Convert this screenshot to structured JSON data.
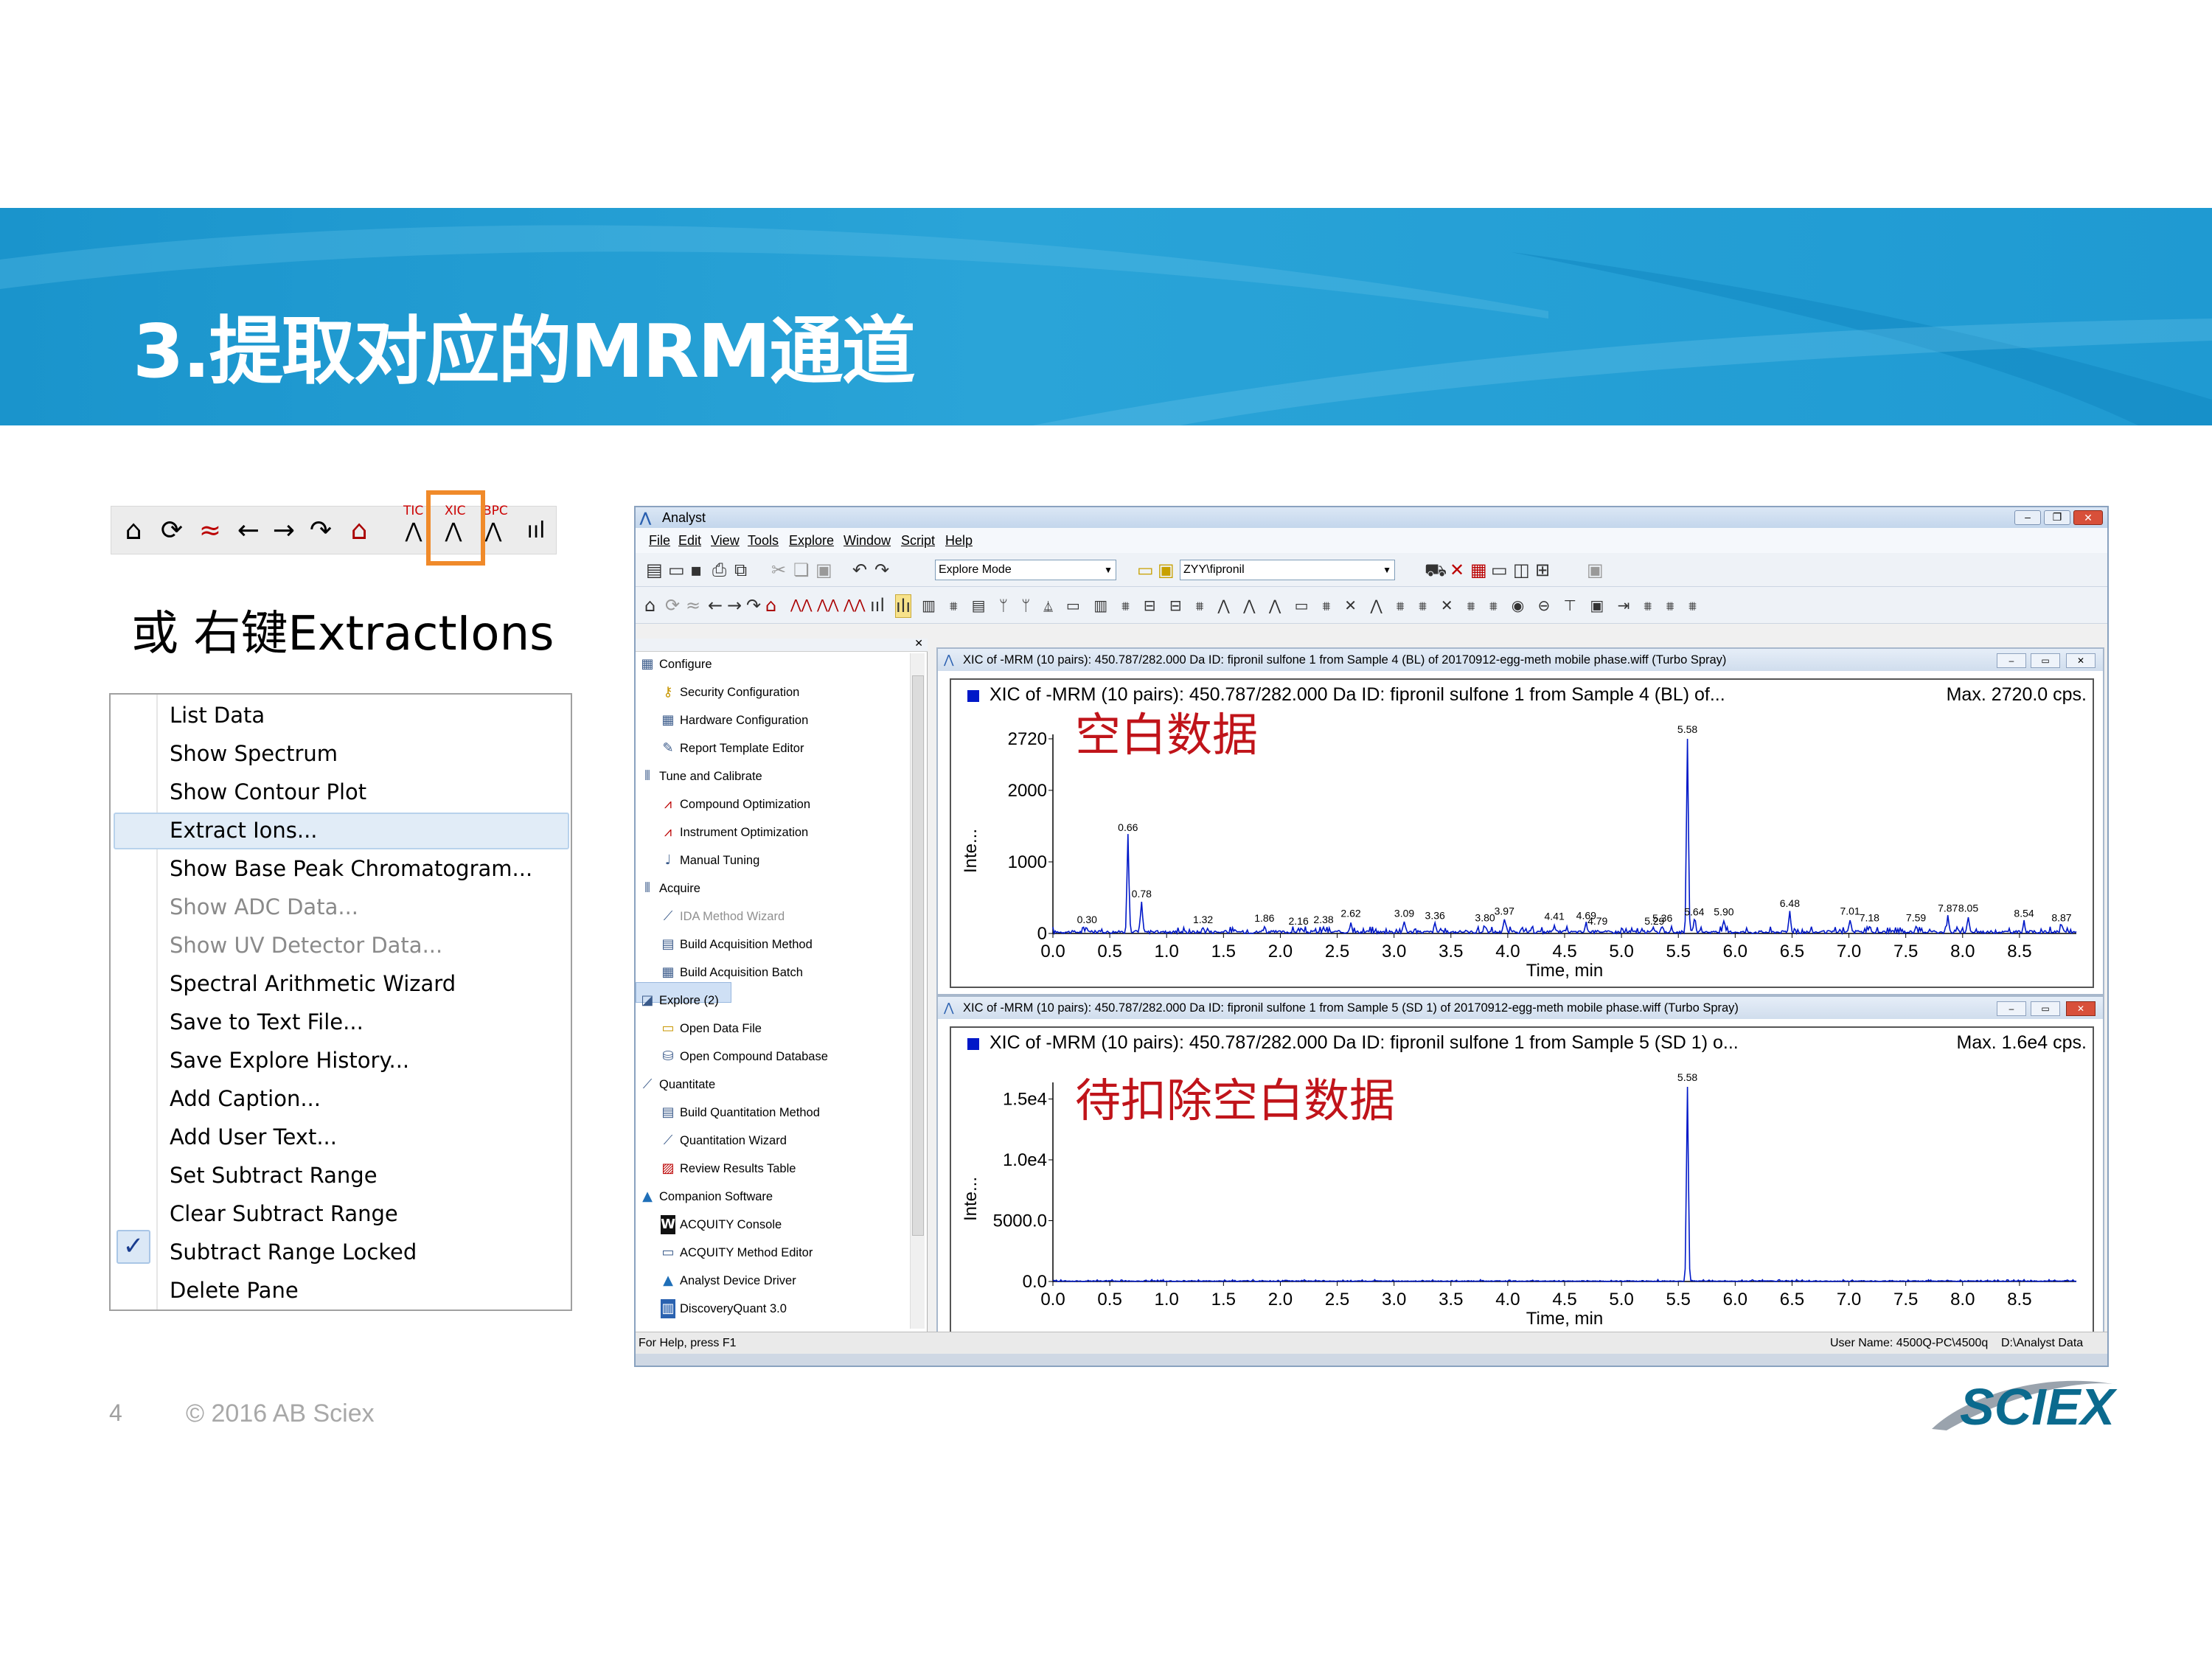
{
  "slide": {
    "title": "3.提取对应的MRM通道",
    "or_text": "或 右键ExtractIons",
    "page_number": "4",
    "copyright": "© 2016 AB Sciex",
    "logo": "SCIEX",
    "brand_color": "#1a94cc",
    "annotation_color": "#c0141a"
  },
  "toolbar_strip": {
    "icons": [
      "home-icon",
      "refresh-icon",
      "cross-wave-icon",
      "arrow-left-icon",
      "arrow-right-icon",
      "redo-icon",
      "calibrate-icon",
      "tic-icon",
      "xic-icon",
      "bpc-icon",
      "spectrum-icon"
    ],
    "labels": {
      "tic": "TIC",
      "xic": "XIC",
      "bpc": "BPC"
    }
  },
  "context_menu": {
    "items": [
      {
        "label": "List Data",
        "disabled": false
      },
      {
        "label": "Show Spectrum",
        "disabled": false
      },
      {
        "label": "Show Contour Plot",
        "disabled": false
      },
      {
        "label": "Extract Ions...",
        "disabled": false,
        "highlighted": true
      },
      {
        "label": "Show Base Peak Chromatogram...",
        "disabled": false
      },
      {
        "label": "Show ADC Data...",
        "disabled": true
      },
      {
        "label": "Show UV Detector Data...",
        "disabled": true
      },
      {
        "label": "Spectral Arithmetic Wizard",
        "disabled": false
      },
      {
        "label": "Save to Text File...",
        "disabled": false
      },
      {
        "label": "Save Explore History...",
        "disabled": false
      },
      {
        "label": "Add Caption...",
        "disabled": false
      },
      {
        "label": "Add User Text...",
        "disabled": false
      },
      {
        "label": "Set Subtract Range",
        "disabled": false
      },
      {
        "label": "Clear Subtract Range",
        "disabled": false
      },
      {
        "label": "Subtract Range Locked",
        "disabled": false,
        "checked": true
      },
      {
        "label": "Delete Pane",
        "disabled": false
      }
    ]
  },
  "analyst": {
    "window_title": "Analyst",
    "menu": [
      "File",
      "Edit",
      "View",
      "Tools",
      "Explore",
      "Window",
      "Script",
      "Help"
    ],
    "mode_combo": "Explore Mode",
    "project_combo": "ZYY\\fipronil",
    "nav": [
      {
        "label": "Configure",
        "level": 0,
        "icon": "configure-icon"
      },
      {
        "label": "Security Configuration",
        "level": 1,
        "icon": "key-icon"
      },
      {
        "label": "Hardware Configuration",
        "level": 1,
        "icon": "hardware-icon"
      },
      {
        "label": "Report Template Editor",
        "level": 1,
        "icon": "report-icon"
      },
      {
        "label": "Tune and Calibrate",
        "level": 0,
        "icon": "tune-icon"
      },
      {
        "label": "Compound Optimization",
        "level": 1,
        "icon": "compound-icon"
      },
      {
        "label": "Instrument Optimization",
        "level": 1,
        "icon": "instrument-icon"
      },
      {
        "label": "Manual Tuning",
        "level": 1,
        "icon": "manual-tuning-icon"
      },
      {
        "label": "Acquire",
        "level": 0,
        "icon": "acquire-icon"
      },
      {
        "label": "IDA Method Wizard",
        "level": 1,
        "icon": "wizard-icon",
        "disabled": true
      },
      {
        "label": "Build Acquisition Method",
        "level": 1,
        "icon": "method-icon"
      },
      {
        "label": "Build Acquisition Batch",
        "level": 1,
        "icon": "batch-icon"
      },
      {
        "label": "Explore (2)",
        "level": 0,
        "icon": "explore-icon",
        "selected": true
      },
      {
        "label": "Open Data File",
        "level": 1,
        "icon": "open-folder-icon"
      },
      {
        "label": "Open Compound Database",
        "level": 1,
        "icon": "database-icon"
      },
      {
        "label": "Quantitate",
        "level": 0,
        "icon": "quantitate-icon"
      },
      {
        "label": "Build Quantitation Method",
        "level": 1,
        "icon": "quant-method-icon"
      },
      {
        "label": "Quantitation Wizard",
        "level": 1,
        "icon": "wizard-icon"
      },
      {
        "label": "Review Results Table",
        "level": 1,
        "icon": "results-icon"
      },
      {
        "label": "Companion Software",
        "level": 0,
        "icon": "companion-icon"
      },
      {
        "label": "ACQUITY Console",
        "level": 1,
        "icon": "acquity-icon"
      },
      {
        "label": "ACQUITY Method Editor",
        "level": 1,
        "icon": "acquity-editor-icon"
      },
      {
        "label": "Analyst Device Driver",
        "level": 1,
        "icon": "driver-icon"
      },
      {
        "label": "DiscoveryQuant 3.0",
        "level": 1,
        "icon": "discoveryquant-icon"
      }
    ],
    "status_left": "For Help, press F1",
    "status_user": "User Name: 4500Q-PC\\4500q",
    "status_path": "D:\\Analyst Data"
  },
  "panes": [
    {
      "title": "XIC of -MRM (10 pairs): 450.787/282.000 Da ID: fipronil sulfone 1 from Sample 4 (BL) of 20170912-egg-meth mobile phase.wiff (Turbo Spray)",
      "header": "XIC of -MRM (10 pairs): 450.787/282.000 Da ID: fipronil sulfone 1 from Sample 4 (BL) of...",
      "max": "Max. 2720.0 cps.",
      "annotation": "空白数据",
      "ylabel": "Inte...",
      "xlabel": "Time, min"
    },
    {
      "title": "XIC of -MRM (10 pairs): 450.787/282.000 Da ID: fipronil sulfone 1 from Sample 5 (SD 1) of 20170912-egg-meth mobile phase.wiff (Turbo Spray)",
      "header": "XIC of -MRM (10 pairs): 450.787/282.000 Da ID: fipronil sulfone 1 from Sample 5 (SD 1) o...",
      "max": "Max. 1.6e4 cps.",
      "annotation": "待扣除空白数据",
      "ylabel": "Inte...",
      "xlabel": "Time, min"
    }
  ],
  "chart_data": [
    {
      "type": "line",
      "title": "XIC of -MRM (10 pairs): 450.787/282.000 Da ID: fipronil sulfone 1 from Sample 4 (BL) of...",
      "xlabel": "Time, min",
      "ylabel": "Inte...",
      "xlim": [
        0.0,
        9.0
      ],
      "ylim": [
        0,
        2720
      ],
      "xticks": [
        "0.0",
        "0.5",
        "1.0",
        "1.5",
        "2.0",
        "2.5",
        "3.0",
        "3.5",
        "4.0",
        "4.5",
        "5.0",
        "5.5",
        "6.0",
        "6.5",
        "7.0",
        "7.5",
        "8.0",
        "8.5"
      ],
      "yticks": [
        {
          "v": 0,
          "l": "0"
        },
        {
          "v": 1000,
          "l": "1000"
        },
        {
          "v": 2000,
          "l": "2000"
        },
        {
          "v": 2720,
          "l": "2720"
        }
      ],
      "peaks": [
        {
          "x": 0.3,
          "y": 60,
          "label": "0.30"
        },
        {
          "x": 0.66,
          "y": 1350,
          "label": "0.66"
        },
        {
          "x": 0.78,
          "y": 420,
          "label": "0.78"
        },
        {
          "x": 1.32,
          "y": 60,
          "label": "1.32"
        },
        {
          "x": 1.86,
          "y": 80,
          "label": "1.86"
        },
        {
          "x": 2.16,
          "y": 40,
          "label": "2.16"
        },
        {
          "x": 2.38,
          "y": 60,
          "label": "2.38"
        },
        {
          "x": 2.62,
          "y": 150,
          "label": "2.62"
        },
        {
          "x": 3.09,
          "y": 150,
          "label": "3.09"
        },
        {
          "x": 3.36,
          "y": 120,
          "label": "3.36"
        },
        {
          "x": 3.8,
          "y": 90,
          "label": "3.80"
        },
        {
          "x": 3.97,
          "y": 180,
          "label": "3.97"
        },
        {
          "x": 4.41,
          "y": 110,
          "label": "4.41"
        },
        {
          "x": 4.69,
          "y": 120,
          "label": "4.69"
        },
        {
          "x": 4.79,
          "y": 40,
          "label": "4.79"
        },
        {
          "x": 5.29,
          "y": 40,
          "label": "5.29"
        },
        {
          "x": 5.36,
          "y": 80,
          "label": "5.36"
        },
        {
          "x": 5.58,
          "y": 2720,
          "label": "5.58"
        },
        {
          "x": 5.64,
          "y": 170,
          "label": "5.64"
        },
        {
          "x": 5.9,
          "y": 170,
          "label": "5.90"
        },
        {
          "x": 6.48,
          "y": 290,
          "label": "6.48"
        },
        {
          "x": 7.01,
          "y": 180,
          "label": "7.01"
        },
        {
          "x": 7.18,
          "y": 90,
          "label": "7.18"
        },
        {
          "x": 7.59,
          "y": 90,
          "label": "7.59"
        },
        {
          "x": 7.87,
          "y": 220,
          "label": "7.87"
        },
        {
          "x": 8.05,
          "y": 220,
          "label": "8.05"
        },
        {
          "x": 8.54,
          "y": 150,
          "label": "8.54"
        },
        {
          "x": 8.87,
          "y": 90,
          "label": "8.87"
        }
      ]
    },
    {
      "type": "line",
      "title": "XIC of -MRM (10 pairs): 450.787/282.000 Da ID: fipronil sulfone 1 from Sample 5 (SD 1) o...",
      "xlabel": "Time, min",
      "ylabel": "Inte...",
      "xlim": [
        0.0,
        9.0
      ],
      "ylim": [
        0,
        16000
      ],
      "xticks": [
        "0.0",
        "0.5",
        "1.0",
        "1.5",
        "2.0",
        "2.5",
        "3.0",
        "3.5",
        "4.0",
        "4.5",
        "5.0",
        "5.5",
        "6.0",
        "6.5",
        "7.0",
        "7.5",
        "8.0",
        "8.5"
      ],
      "yticks": [
        {
          "v": 0,
          "l": "0.0"
        },
        {
          "v": 5000,
          "l": "5000.0"
        },
        {
          "v": 10000,
          "l": "1.0e4"
        },
        {
          "v": 15000,
          "l": "1.5e4"
        }
      ],
      "peaks": [
        {
          "x": 5.58,
          "y": 16000,
          "label": "5.58"
        }
      ]
    }
  ]
}
